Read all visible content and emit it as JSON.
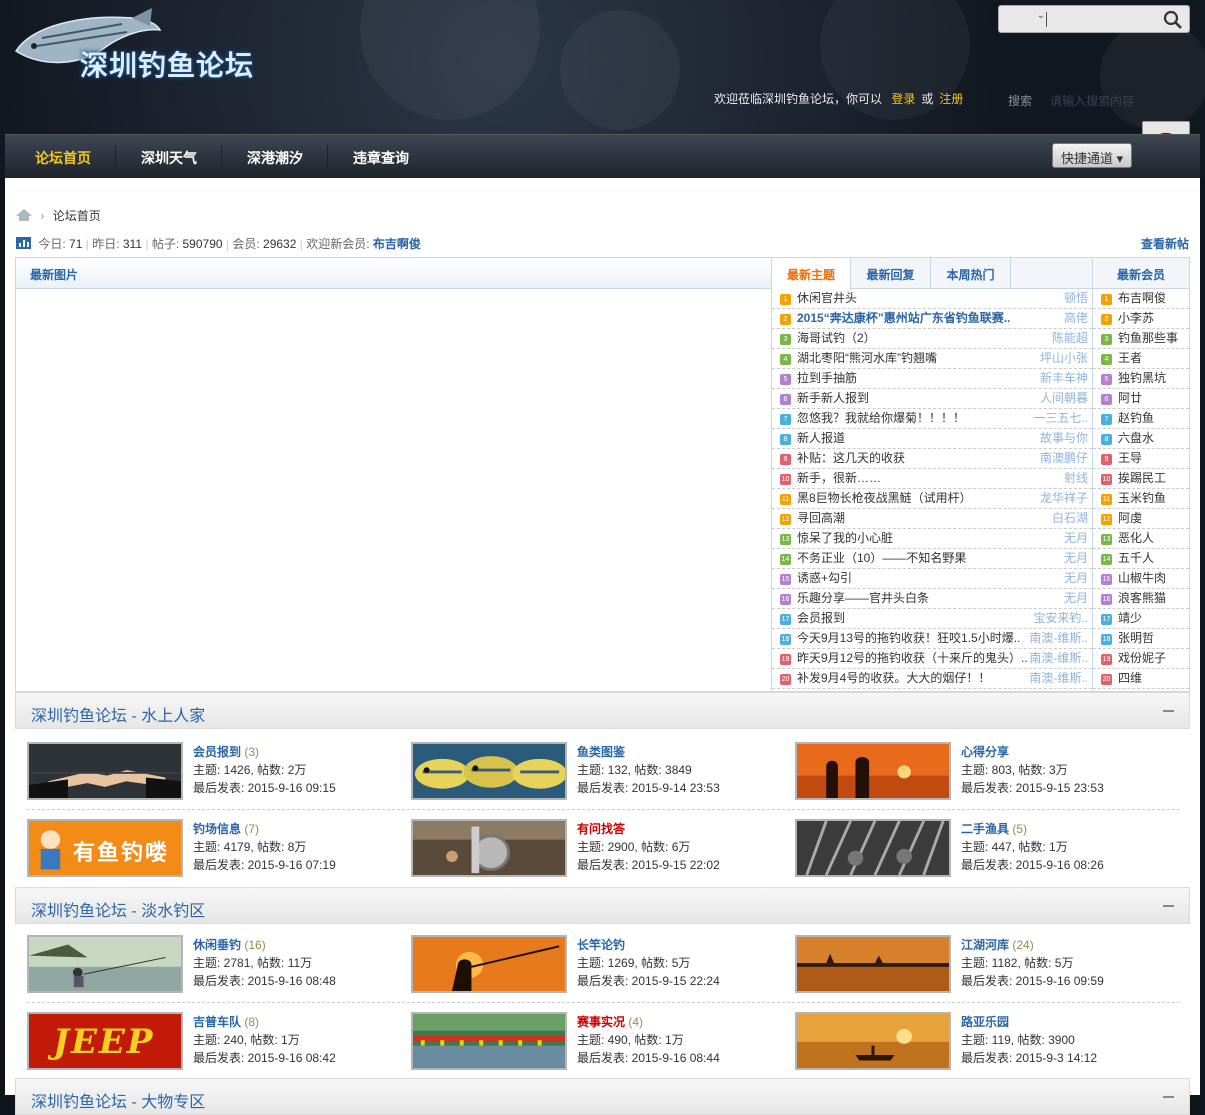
{
  "header": {
    "logo_text": "深圳钓鱼论坛",
    "welcome": "欢迎莅临深圳钓鱼论坛，你可以",
    "login": "登录",
    "or": "或",
    "register": "注册",
    "search_label": "搜索",
    "search_placeholder": "请输入搜索内容",
    "select_caret": "⌄"
  },
  "nav": {
    "items": [
      "论坛首页",
      "深圳天气",
      "深港潮汐",
      "违章查询"
    ],
    "quick": "快捷通道 ▾",
    "active_color": "#f2c521"
  },
  "breadcrumb": {
    "current": "论坛首页"
  },
  "stats": {
    "today_label": "今日:",
    "today": "71",
    "yesterday_label": "昨日:",
    "yesterday": "311",
    "posts_label": "帖子:",
    "posts": "590790",
    "members_label": "会员:",
    "members": "29632",
    "newest_label": "欢迎新会员:",
    "newest": "布吉啊俊",
    "view_new": "查看新帖"
  },
  "latest_images": {
    "title": "最新图片"
  },
  "topic_tabs": [
    "最新主题",
    "最新回复",
    "本周热门"
  ],
  "topics": [
    {
      "n": "1",
      "title": "休闲官井头",
      "author": "顿悟",
      "hl": false
    },
    {
      "n": "2",
      "title": "2015“奔达康杯”惠州站广东省钓鱼联赛..",
      "author": "高佬",
      "hl": true
    },
    {
      "n": "3",
      "title": "海哥试钓（2）",
      "author": "陈能超",
      "hl": false
    },
    {
      "n": "4",
      "title": "湖北枣阳“熊河水库”钓翘嘴",
      "author": "坪山小张",
      "hl": false
    },
    {
      "n": "5",
      "title": "拉到手抽筋",
      "author": "新丰车神",
      "hl": false
    },
    {
      "n": "6",
      "title": "新手新人报到",
      "author": "人间朝暮",
      "hl": false
    },
    {
      "n": "7",
      "title": "忽悠我？我就给你爆菊！！！！",
      "author": "一三五七..",
      "hl": false
    },
    {
      "n": "8",
      "title": "新人报道",
      "author": "故事与你",
      "hl": false
    },
    {
      "n": "9",
      "title": "补贴：这几天的收获",
      "author": "南澳鹏仔",
      "hl": false
    },
    {
      "n": "10",
      "title": "新手，很新……",
      "author": "射线",
      "hl": false
    },
    {
      "n": "11",
      "title": "黑8巨物长枪夜战黑鲢（试用杆）",
      "author": "龙华祥子",
      "hl": false
    },
    {
      "n": "12",
      "title": "寻回高潮",
      "author": "白石湖",
      "hl": false
    },
    {
      "n": "13",
      "title": "惊呆了我的小心脏",
      "author": "无月",
      "hl": false
    },
    {
      "n": "14",
      "title": "不务正业（10）——不知名野果",
      "author": "无月",
      "hl": false
    },
    {
      "n": "15",
      "title": "诱惑+勾引",
      "author": "无月",
      "hl": false
    },
    {
      "n": "16",
      "title": "乐趣分享——官井头白条",
      "author": "无月",
      "hl": false
    },
    {
      "n": "17",
      "title": "会员报到",
      "author": "宝安来钓..",
      "hl": false
    },
    {
      "n": "18",
      "title": "今天9月13号的拖钓收获！狂咬1.5小时爆..",
      "author": "南澳-维斯..",
      "hl": false
    },
    {
      "n": "19",
      "title": "昨天9月12号的拖钓收获（十来斤的鬼头）..",
      "author": "南澳-维斯..",
      "hl": false
    },
    {
      "n": "20",
      "title": "补发9月4号的收获。大大的烟仔！！",
      "author": "南澳-维斯..",
      "hl": false
    }
  ],
  "members_box": {
    "title": "最新会员",
    "list": [
      "布吉啊俊",
      "小李苏",
      "钓鱼那些事",
      "王者",
      "独钓黑坑",
      "阿廿",
      "赵钓鱼",
      "六盘水",
      "王导",
      "挨踢民工",
      "玉米钓鱼",
      "阿虔",
      "恶化人",
      "五千人",
      "山椒牛肉",
      "浪客熊猫",
      "靖少",
      "张明哲",
      "戏份妮子",
      "四维"
    ]
  },
  "num_colors": [
    "#f5a100",
    "#f5a100",
    "#7ab648",
    "#7ab648",
    "#b57fd1",
    "#b57fd1",
    "#4ab0e0",
    "#4ab0e0",
    "#e0616b",
    "#e0616b",
    "#f5a100",
    "#f5a100",
    "#7ab648",
    "#7ab648",
    "#b57fd1",
    "#b57fd1",
    "#4ab0e0",
    "#4ab0e0",
    "#e0616b",
    "#e0616b"
  ],
  "sections": [
    {
      "title": "深圳钓鱼论坛 - 水上人家",
      "forums": [
        {
          "name": "会员报到",
          "count": "(3)",
          "stats": "主题: 1426, 帖数: 2万",
          "last": "最后发表: 2015-9-16 09:15",
          "red": false,
          "thumb": "handshake"
        },
        {
          "name": "鱼类图鉴",
          "count": "",
          "stats": "主题: 132, 帖数: 3849",
          "last": "最后发表: 2015-9-14 23:53",
          "red": false,
          "thumb": "fish"
        },
        {
          "name": "心得分享",
          "count": "",
          "stats": "主题: 803, 帖数: 3万",
          "last": "最后发表: 2015-9-15 23:53",
          "red": false,
          "thumb": "sunset"
        },
        {
          "name": "钓场信息",
          "count": "(7)",
          "stats": "主题: 4179, 帖数: 8万",
          "last": "最后发表: 2015-9-16 07:19",
          "red": false,
          "thumb": "banner",
          "banner_text": "有鱼钓喽"
        },
        {
          "name": "有问找答",
          "count": "",
          "stats": "主题: 2900, 帖数: 6万",
          "last": "最后发表: 2015-9-15 22:02",
          "red": true,
          "thumb": "reel"
        },
        {
          "name": "二手渔具",
          "count": "(5)",
          "stats": "主题: 447, 帖数: 1万",
          "last": "最后发表: 2015-9-16 08:26",
          "red": false,
          "thumb": "rods"
        }
      ]
    },
    {
      "title": "深圳钓鱼论坛 - 淡水钓区",
      "forums": [
        {
          "name": "休闲垂钓",
          "count": "(16)",
          "stats": "主题: 2781, 帖数: 11万",
          "last": "最后发表: 2015-9-16 08:48",
          "red": false,
          "thumb": "lake"
        },
        {
          "name": "长竿论钓",
          "count": "",
          "stats": "主题: 1269, 帖数: 5万",
          "last": "最后发表: 2015-9-15 22:24",
          "red": false,
          "thumb": "orange"
        },
        {
          "name": "江湖河库",
          "count": "(24)",
          "stats": "主题: 1182, 帖数: 5万",
          "last": "最后发表: 2015-9-16 09:59",
          "red": false,
          "thumb": "dusk"
        },
        {
          "name": "吉普车队",
          "count": "(8)",
          "stats": "主题: 240, 帖数: 1万",
          "last": "最后发表: 2015-9-16 08:42",
          "red": false,
          "thumb": "jeep",
          "banner_text": "JEEP"
        },
        {
          "name": "赛事实况",
          "count": "(4)",
          "stats": "主题: 490, 帖数: 1万",
          "last": "最后发表: 2015-9-16 08:44",
          "red": true,
          "thumb": "match"
        },
        {
          "name": "路亚乐园",
          "count": "",
          "stats": "主题: 119, 帖数: 3900",
          "last": "最后发表: 2015-9-3 14:12",
          "red": false,
          "thumb": "boat"
        }
      ]
    },
    {
      "title": "深圳钓鱼论坛 - 大物专区",
      "forums": []
    }
  ]
}
